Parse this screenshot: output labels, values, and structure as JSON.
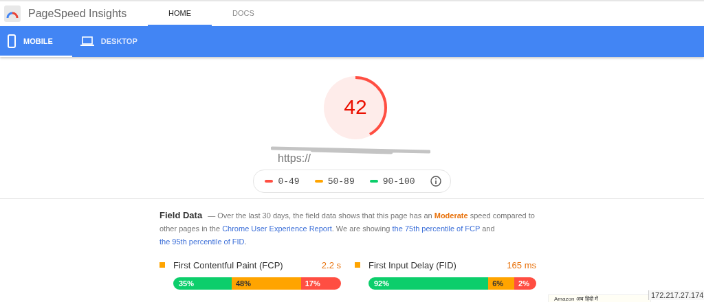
{
  "header": {
    "title": "PageSpeed Insights",
    "tabs": [
      {
        "label": "HOME",
        "selected": true
      },
      {
        "label": "DOCS",
        "selected": false
      }
    ]
  },
  "device_tabs": [
    {
      "label": "MOBILE",
      "kind": "phone",
      "selected": true
    },
    {
      "label": "DESKTOP",
      "kind": "laptop",
      "selected": false
    }
  ],
  "score": {
    "value": "42",
    "level": 0.42
  },
  "url": "https://",
  "legend": [
    {
      "range": "0-49",
      "color": "#ff4e42"
    },
    {
      "range": "50-89",
      "color": "#ffa400"
    },
    {
      "range": "90-100",
      "color": "#0cce6b"
    }
  ],
  "field_data": {
    "title": "Field Data",
    "description": [
      {
        "text": "— Over the last 30 days, the field data shows that this page has an ",
        "kind": "plain"
      },
      {
        "text": "Moderate",
        "kind": "rating"
      },
      {
        "text": " speed compared to other pages in the ",
        "kind": "plain"
      },
      {
        "text": "Chrome User Experience Report",
        "kind": "link"
      },
      {
        "text": ". We are showing ",
        "kind": "plain"
      },
      {
        "text": "the 75th percentile of FCP",
        "kind": "link"
      },
      {
        "text": " and ",
        "kind": "plain"
      },
      {
        "text": "the 95th percentile of FID",
        "kind": "link"
      },
      {
        "text": ".",
        "kind": "plain"
      }
    ],
    "metrics": [
      {
        "name": "First Contentful Paint (FCP)",
        "value": "2.2 s",
        "color": "#ffa400",
        "segments": [
          {
            "label": "35%",
            "kind": "fast"
          },
          {
            "label": "48%",
            "kind": "average"
          },
          {
            "label": "17%",
            "kind": "slow"
          }
        ]
      },
      {
        "name": "First Input Delay (FID)",
        "value": "165 ms",
        "color": "#ffa400",
        "segments": [
          {
            "label": "92%",
            "kind": "fast"
          },
          {
            "label": "6%",
            "kind": "average"
          },
          {
            "label": "2%",
            "kind": "slow"
          }
        ]
      }
    ]
  },
  "overlay": {
    "popup": "Amazon अब हिंदी में",
    "address": "172.217.27.174"
  }
}
